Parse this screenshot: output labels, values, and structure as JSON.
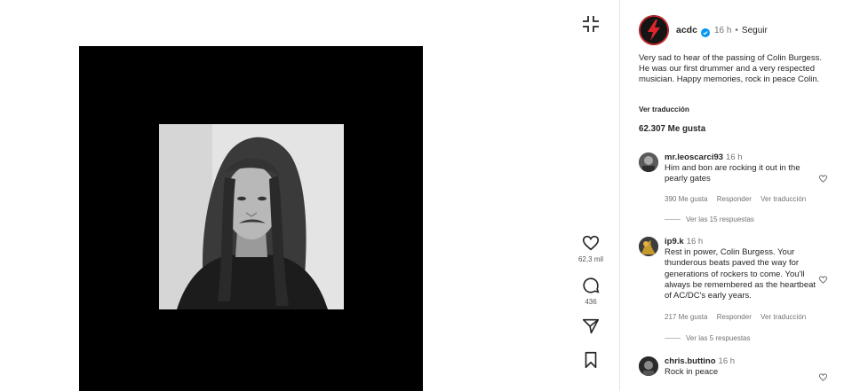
{
  "media": {
    "icons": {
      "photo": "portrait-photo"
    }
  },
  "actions": {
    "collapse_icon": "collapse-icon",
    "like_count": "62,3 mil",
    "comment_count": "436"
  },
  "post": {
    "username": "acdc",
    "time": "16 h",
    "separator": "•",
    "follow_label": "Seguir",
    "caption": "Very sad to hear of the passing of Colin Burgess. He was our first drummer and a very respected musician. Happy memories, rock in peace Colin.",
    "translate_label": "Ver traducción",
    "likes": "62.307 Me gusta"
  },
  "comments": [
    {
      "username": "mr.leoscarci93",
      "time": "16 h",
      "text": "Him and bon are rocking it out in the pearly gates",
      "likes": "390 Me gusta",
      "reply_label": "Responder",
      "translate_label": "Ver traducción",
      "replies": "Ver las 15 respuestas"
    },
    {
      "username": "ip9.k",
      "time": "16 h",
      "text": "Rest in power, Colin Burgess. Your thunderous beats paved the way for generations of rockers to come. You'll always be remembered as the heartbeat of AC/DC's early years.",
      "likes": "217 Me gusta",
      "reply_label": "Responder",
      "translate_label": "Ver traducción",
      "replies": "Ver las 5 respuestas"
    },
    {
      "username": "chris.buttino",
      "time": "16 h",
      "text": "Rock in peace"
    }
  ],
  "colors": {
    "text": "#262626",
    "muted": "#737373",
    "verified": "#0095f6",
    "brand_red": "#e0262b"
  }
}
